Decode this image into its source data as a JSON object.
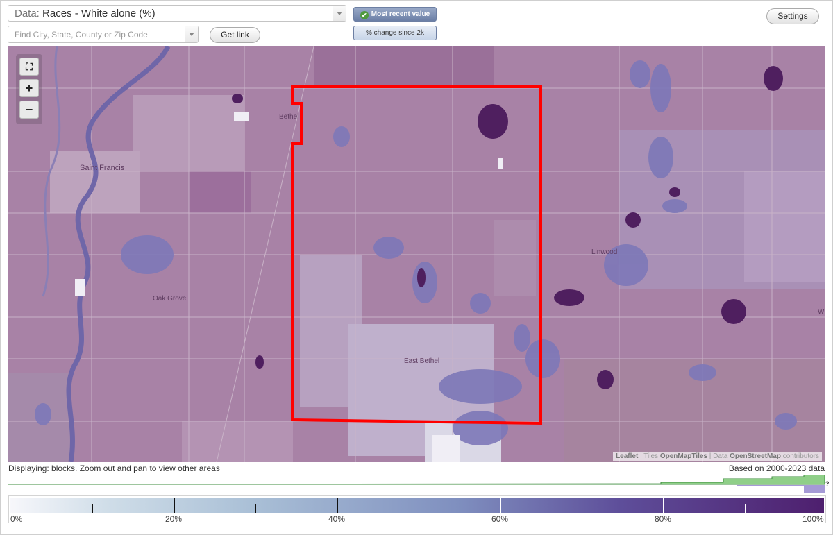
{
  "controls": {
    "data_label": "Data:",
    "data_value": "Races - White alone (%)",
    "search_placeholder": "Find City, State, County or Zip Code",
    "get_link_label": "Get link",
    "most_recent_label": "Most recent value",
    "change_label": "% change since 2k",
    "settings_label": "Settings"
  },
  "map": {
    "zoom_fit_icon": "fit-bounds-icon",
    "zoom_in_label": "+",
    "zoom_out_label": "−",
    "place_labels": [
      "Bethel",
      "Saint Francis",
      "Oak Grove",
      "Linwood",
      "East Bethel",
      "W"
    ],
    "attribution": {
      "leaflet": "Leaflet",
      "tiles_prefix": "Tiles",
      "tiles": "OpenMapTiles",
      "data_prefix": "Data",
      "data": "OpenStreetMap",
      "data_suffix": "contributors"
    },
    "highlight_color": "#ff0000",
    "fill_color": "#a882a6",
    "water_color": "#7d78b8"
  },
  "footer": {
    "displaying": "Displaying: blocks. Zoom out and pan to view other areas",
    "based_on": "Based on 2000-2023 data",
    "hist_question": "?"
  },
  "legend": {
    "labels": [
      "0%",
      "20%",
      "40%",
      "60%",
      "80%",
      "100%"
    ]
  }
}
